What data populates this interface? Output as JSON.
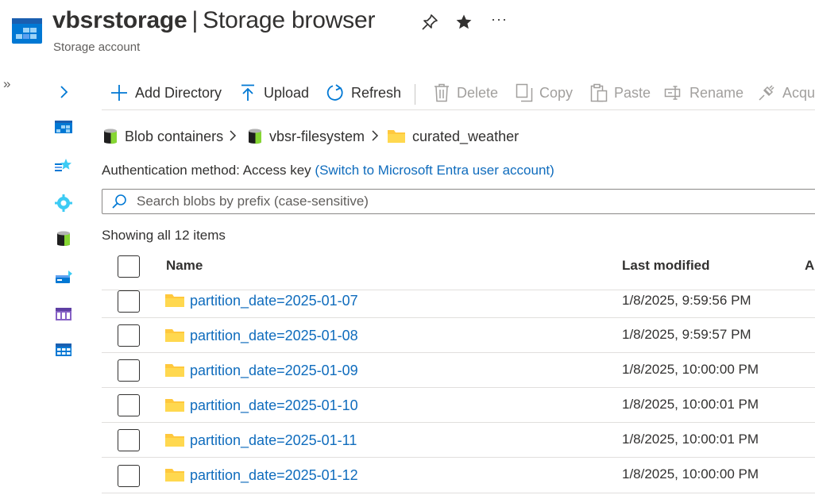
{
  "header": {
    "resource_name": "vbsrstorage",
    "separator": "|",
    "page_name": "Storage browser",
    "subtitle": "Storage account",
    "more": "···"
  },
  "left_rail": {
    "expand_glyph": "»",
    "icons": [
      "chevron-right-icon",
      "storage-account-icon",
      "favorites-icon",
      "settings-icon",
      "blob-containers-icon",
      "file-shares-icon",
      "queues-icon",
      "tables-icon"
    ]
  },
  "toolbar": {
    "add_directory": "Add Directory",
    "upload": "Upload",
    "refresh": "Refresh",
    "delete": "Delete",
    "copy": "Copy",
    "paste": "Paste",
    "rename": "Rename",
    "acquire": "Acqu"
  },
  "breadcrumb": {
    "items": [
      "Blob containers",
      "vbsr-filesystem",
      "curated_weather"
    ]
  },
  "auth": {
    "label": "Authentication method:",
    "value": "Access key",
    "link": "(Switch to Microsoft Entra user account)"
  },
  "search": {
    "placeholder": "Search blobs by prefix (case-sensitive)",
    "value": ""
  },
  "status": {
    "showing": "Showing all 12 items"
  },
  "table": {
    "columns": [
      "Name",
      "Last modified",
      "A"
    ],
    "rows": [
      {
        "name": "partition_date=2025-01-07",
        "modified": "1/8/2025, 9:59:56 PM"
      },
      {
        "name": "partition_date=2025-01-08",
        "modified": "1/8/2025, 9:59:57 PM"
      },
      {
        "name": "partition_date=2025-01-09",
        "modified": "1/8/2025, 10:00:00 PM"
      },
      {
        "name": "partition_date=2025-01-10",
        "modified": "1/8/2025, 10:00:01 PM"
      },
      {
        "name": "partition_date=2025-01-11",
        "modified": "1/8/2025, 10:00:01 PM"
      },
      {
        "name": "partition_date=2025-01-12",
        "modified": "1/8/2025, 10:00:00 PM"
      }
    ]
  },
  "colors": {
    "link": "#0f6cbd",
    "folder": "#ffc83d",
    "azure_blue": "#0078d4"
  }
}
